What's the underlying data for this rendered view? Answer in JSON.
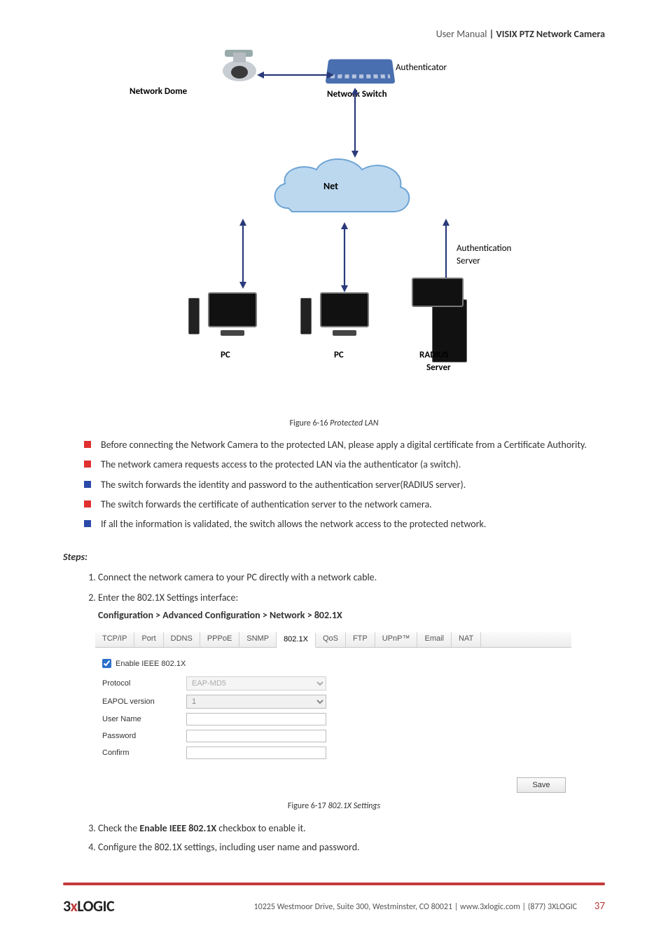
{
  "header": {
    "light": "User Manual ",
    "bold": "| VISIX PTZ Network Camera"
  },
  "diagram": {
    "network_dome": "Network Dome",
    "authenticator": "Authenticator",
    "network_switch": "Network Switch",
    "net": "Net",
    "auth_server_line1": "Authentication",
    "auth_server_line2": "Server",
    "pc1": "PC",
    "pc2": "PC",
    "radius_line1": "RADIUS",
    "radius_line2": "Server"
  },
  "fig1": {
    "prefix": "Figure 6-16",
    "title": " Protected LAN"
  },
  "bullets": [
    "Before connecting the Network Camera to the protected LAN, please apply a digital certificate from a Certificate Authority.",
    "The network camera requests access to the protected LAN via the authenticator (a switch).",
    "The switch forwards the identity and password to the authentication server(RADIUS server).",
    "The switch forwards the certificate of authentication server to the network camera.",
    "If all the information is validated, the switch allows the network access to the protected network."
  ],
  "bullet_colors": [
    "#e03030",
    "#e03030",
    "#2b4aa8",
    "#e03030",
    "#2b4aa8"
  ],
  "steps_heading": "Steps:",
  "steps": [
    "Connect the network camera to your PC directly with a network cable.",
    "Enter the 802.1X Settings interface:"
  ],
  "step2_breadcrumb": "Configuration > Advanced Configuration > Network > 802.1X",
  "tabs": [
    "TCP/IP",
    "Port",
    "DDNS",
    "PPPoE",
    "SNMP",
    "802.1X",
    "QoS",
    "FTP",
    "UPnP™",
    "Email",
    "NAT"
  ],
  "active_tab_index": 5,
  "panel": {
    "enable_label": "Enable IEEE 802.1X",
    "enable_checked": true,
    "rows": {
      "protocol_label": "Protocol",
      "protocol_value": "EAP-MD5",
      "eapol_label": "EAPOL version",
      "eapol_value": "1",
      "user_label": "User Name",
      "user_value": "",
      "pwd_label": "Password",
      "pwd_value": "",
      "confirm_label": "Confirm",
      "confirm_value": ""
    },
    "save_label": "Save"
  },
  "fig2": {
    "prefix": "Figure 6-17",
    "title": " 802.1X Settings"
  },
  "steps2": [
    [
      "Check the ",
      "Enable IEEE 802.1X",
      " checkbox to enable it."
    ],
    [
      "Configure the 802.1X settings, including user name and password."
    ]
  ],
  "footer": {
    "logo_3": "3",
    "logo_x": "x",
    "logo_rest": "LOGIC",
    "address": "10225 Westmoor Drive, Suite 300, Westminster, CO 80021 | www.3xlogic.com | (877) 3XLOGIC",
    "page": "37"
  }
}
